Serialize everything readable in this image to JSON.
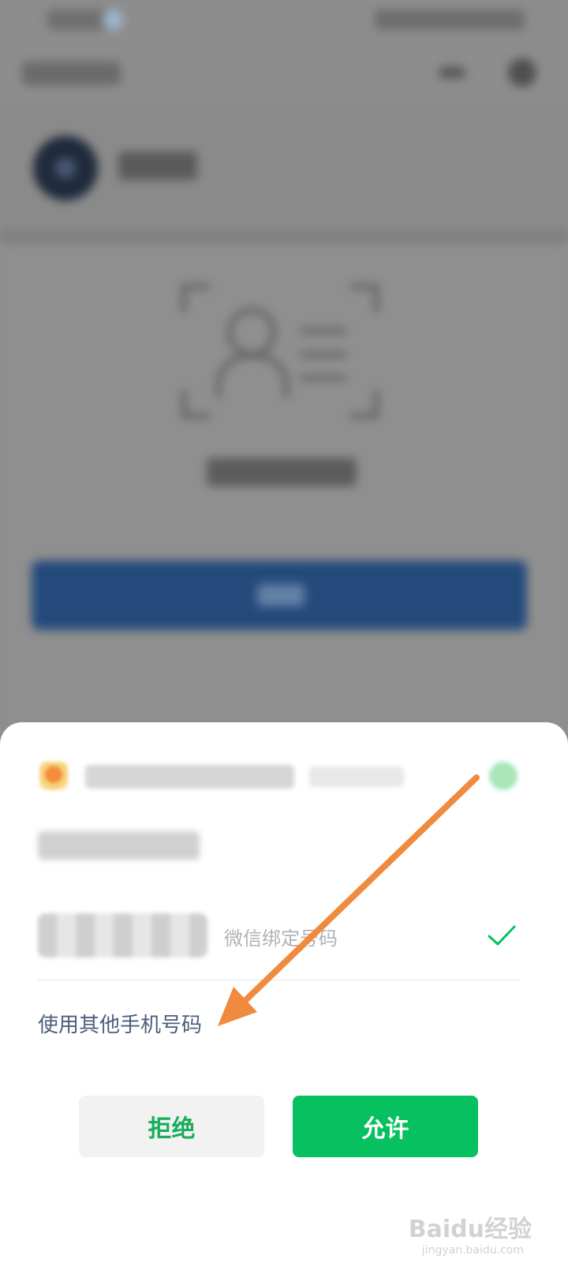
{
  "sheet": {
    "phone_option": {
      "label": "微信绑定号码"
    },
    "other_phone_link": "使用其他手机号码",
    "reject_button": "拒绝",
    "allow_button": "允许"
  },
  "watermark": {
    "brand": "Baidu经验",
    "url": "jingyan.baidu.com"
  },
  "colors": {
    "allow_green": "#07c160",
    "reject_text_green": "#1aad5b",
    "link_blue": "#4d5d7d",
    "annotation_orange": "#f08a3e"
  },
  "icons": {
    "selected": "check-icon",
    "annotation": "arrow-annotation"
  }
}
